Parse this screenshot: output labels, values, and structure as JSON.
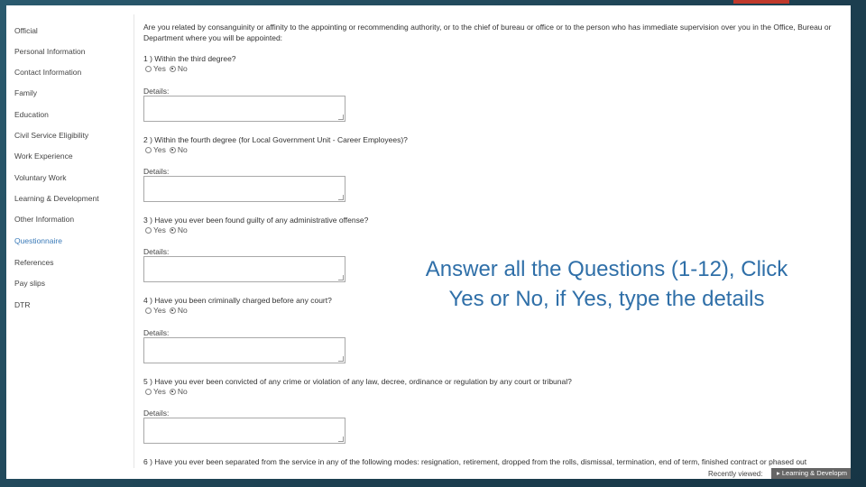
{
  "overlay": {
    "line1": "Answer all the Questions (1-12), Click",
    "line2": "Yes or No, if Yes, type the details"
  },
  "sidebar": {
    "items": [
      {
        "label": "Official"
      },
      {
        "label": "Personal Information"
      },
      {
        "label": "Contact Information"
      },
      {
        "label": "Family"
      },
      {
        "label": "Education"
      },
      {
        "label": "Civil Service Eligibility"
      },
      {
        "label": "Work Experience"
      },
      {
        "label": "Voluntary Work"
      },
      {
        "label": "Learning & Development"
      },
      {
        "label": "Other Information"
      },
      {
        "label": "Questionnaire"
      },
      {
        "label": "References"
      },
      {
        "label": "Pay slips"
      },
      {
        "label": "DTR"
      }
    ],
    "active_index": 10
  },
  "form": {
    "intro": "Are you related by consanguinity or affinity to the appointing or recommending authority, or to the chief of bureau or office or to the person who has immediate supervision over you in the Office, Bureau or Department where you will be appointed:",
    "yes_label": "Yes",
    "no_label": "No",
    "details_label": "Details:",
    "questions": [
      {
        "text": "1 ) Within the third degree?",
        "selected": "No"
      },
      {
        "text": "2 ) Within the fourth degree (for Local Government Unit - Career Employees)?",
        "selected": "No"
      },
      {
        "text": "3 ) Have you ever been found guilty of any administrative offense?",
        "selected": "No"
      },
      {
        "text": "4 ) Have you been criminally charged before any court?",
        "selected": "No"
      },
      {
        "text": "5 ) Have you ever been convicted of any crime or violation of any law, decree, ordinance or regulation by any court or tribunal?",
        "selected": "No"
      },
      {
        "text": "6 ) Have you ever been separated from the service in any of the following modes: resignation, retirement, dropped from the rolls, dismissal, termination, end of term, finished contract or phased out"
      }
    ]
  },
  "footer": {
    "recently_viewed": "Recently viewed:",
    "recent_item": "Learning & Developm"
  }
}
